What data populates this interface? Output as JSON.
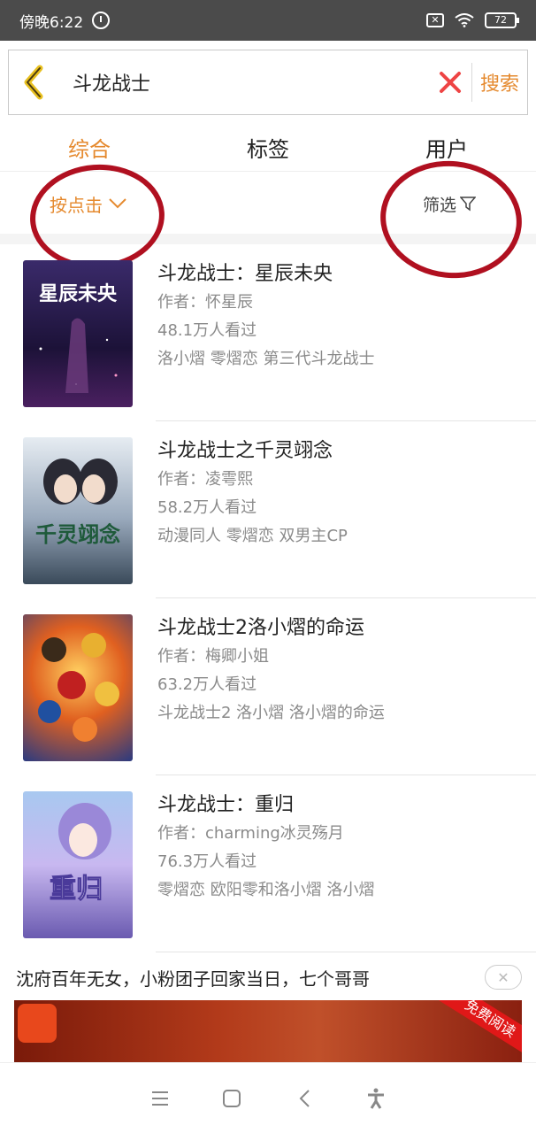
{
  "status_bar": {
    "time": "傍晚6:22",
    "battery": "72"
  },
  "search": {
    "query": "斗龙战士",
    "search_label": "搜索"
  },
  "tabs": [
    {
      "label": "综合",
      "active": true
    },
    {
      "label": "标签",
      "active": false
    },
    {
      "label": "用户",
      "active": false
    }
  ],
  "filters": {
    "sort_label": "按点击",
    "filter_label": "筛选"
  },
  "books": [
    {
      "title": "斗龙战士：星辰未央",
      "author": "作者：怀星辰",
      "views": "48.1万人看过",
      "tags": "洛小熠 零熠恋 第三代斗龙战士",
      "cover_text": "星辰未央",
      "cover_colors": [
        "#2a1a4a",
        "#5a3a8a",
        "#c070d0"
      ]
    },
    {
      "title": "斗龙战士之千灵翊念",
      "author": "作者：凌雩熙",
      "views": "58.2万人看过",
      "tags": "动漫同人 零熠恋 双男主CP",
      "cover_text": "千灵翊念",
      "cover_colors": [
        "#dfe6ee",
        "#8aa0b8",
        "#2a3a4a"
      ]
    },
    {
      "title": "斗龙战士2洛小熠的命运",
      "author": "作者：梅卿小姐",
      "views": "63.2万人看过",
      "tags": "斗龙战士2 洛小熠 洛小熠的命运",
      "cover_text": "",
      "cover_colors": [
        "#f0a020",
        "#d04010",
        "#3050a0"
      ]
    },
    {
      "title": "斗龙战士：重归",
      "author": "作者：charming冰灵殇月",
      "views": "76.3万人看过",
      "tags": "零熠恋 欧阳零和洛小熠 洛小熠",
      "cover_text": "重归",
      "cover_colors": [
        "#b8c8f0",
        "#8070c0",
        "#f0f4ff"
      ]
    }
  ],
  "ad": {
    "text": "沈府百年无女，小粉团子回家当日，七个哥哥",
    "badge": "免费阅读"
  },
  "colors": {
    "accent": "#e58a2f",
    "annotation": "#b01020"
  }
}
